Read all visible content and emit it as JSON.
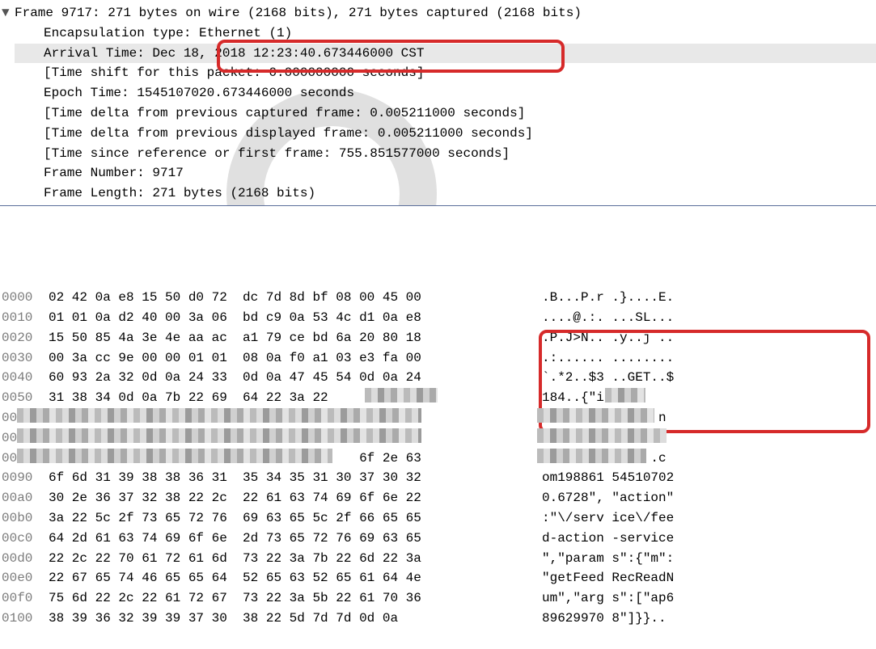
{
  "details": {
    "frame_summary": "Frame 9717: 271 bytes on wire (2168 bits), 271 bytes captured (2168 bits)",
    "encap": "Encapsulation type: Ethernet (1)",
    "arrival_prefix": "Arrival Time: Dec 18,",
    "arrival_boxed": " 2018 12:23:40.673446000 CST",
    "time_shift": "[Time shift for this packet: 0.000000000 seconds]",
    "epoch": "Epoch Time: 1545107020.673446000 seconds",
    "delta_cap": "[Time delta from previous captured frame: 0.005211000 seconds]",
    "delta_disp": "[Time delta from previous displayed frame: 0.005211000 seconds]",
    "since_ref": "[Time since reference or first frame: 755.851577000 seconds]",
    "frame_num": "Frame Number: 9717",
    "frame_len": "Frame Length: 271 bytes (2168 bits)"
  },
  "hex": [
    {
      "off": "0000",
      "b": "02 42 0a e8 15 50 d0 72  dc 7d 8d bf 08 00 45 00",
      "a": ".B...P.r .}....E."
    },
    {
      "off": "0010",
      "b": "01 01 0a d2 40 00 3a 06  bd c9 0a 53 4c d1 0a e8",
      "a": "....@.:. ...SL..."
    },
    {
      "off": "0020",
      "b": "15 50 85 4a 3e 4e aa ac  a1 79 ce bd 6a 20 80 18",
      "a": ".P.J>N.. .y..j .."
    },
    {
      "off": "0030",
      "b": "00 3a cc 9e 00 00 01 01  08 0a f0 a1 03 e3 fa 00",
      "a": ".:...... ........"
    },
    {
      "off": "0040",
      "b": "60 93 2a 32 0d 0a 24 33  0d 0a 47 45 54 0d 0a 24",
      "a": "`.*2..$3 ..GET..$"
    },
    {
      "off": "0050",
      "b": "31 38 34 0d 0a 7b 22 69  64 22 3a 22            ",
      "a": "184..{\"i d\":     "
    },
    {
      "off": "0060",
      "b": "                                                ",
      "a": "               n"
    },
    {
      "off": "0070",
      "b": "                                                ",
      "a": "                "
    },
    {
      "off": "0080",
      "b": "                                        6f 2e 63",
      "a": "              .c"
    },
    {
      "off": "0090",
      "b": "6f 6d 31 39 38 38 36 31  35 34 35 31 30 37 30 32",
      "a": "om198861 54510702"
    },
    {
      "off": "00a0",
      "b": "30 2e 36 37 32 38 22 2c  22 61 63 74 69 6f 6e 22",
      "a": "0.6728\", \"action\""
    },
    {
      "off": "00b0",
      "b": "3a 22 5c 2f 73 65 72 76  69 63 65 5c 2f 66 65 65",
      "a": ":\"\\/serv ice\\/fee"
    },
    {
      "off": "00c0",
      "b": "64 2d 61 63 74 69 6f 6e  2d 73 65 72 76 69 63 65",
      "a": "d-action -service"
    },
    {
      "off": "00d0",
      "b": "22 2c 22 70 61 72 61 6d  73 22 3a 7b 22 6d 22 3a",
      "a": "\",\"param s\":{\"m\":"
    },
    {
      "off": "00e0",
      "b": "22 67 65 74 46 65 65 64  52 65 63 52 65 61 64 4e",
      "a": "\"getFeed RecReadN"
    },
    {
      "off": "00f0",
      "b": "75 6d 22 2c 22 61 72 67  73 22 3a 5b 22 61 70 36",
      "a": "um\",\"arg s\":[\"ap6"
    },
    {
      "off": "0100",
      "b": "38 39 36 32 39 39 37 30  38 22 5d 7d 7d 0d 0a   ",
      "a": "89629970 8\"]}}.. "
    }
  ]
}
